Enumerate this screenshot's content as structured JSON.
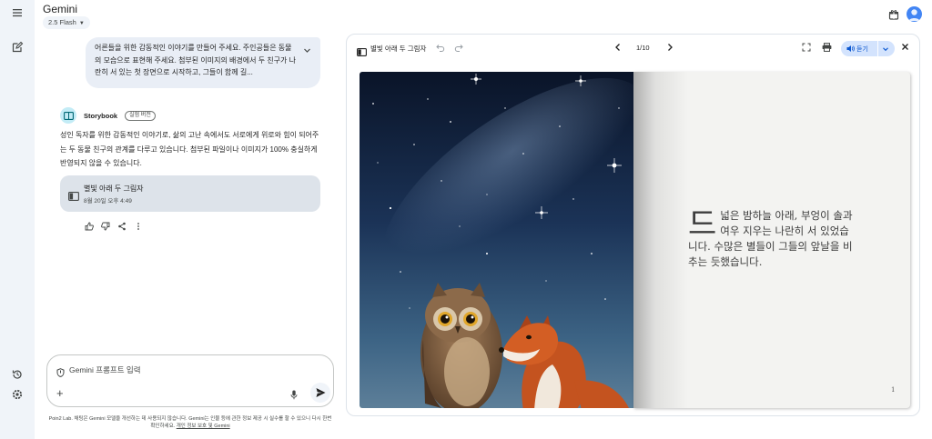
{
  "app": {
    "title": "Gemini",
    "model_label": "2.5 Flash"
  },
  "user_prompt": {
    "text": "어른들을 위한 감동적인 이야기를 만들어 주세요. 주인공들은 동물의 모습으로 표현해 주세요. 첨부된 이미지의 배경에서 두 친구가 나란히 서 있는 첫 장면으로 시작하고, 그들이 함께 길..."
  },
  "response": {
    "source_name": "Storybook",
    "source_badge": "실험 버전",
    "text": "성인 독자를 위한 감동적인 이야기로, 삶의 고난 속에서도 서로에게 위로와 힘이 되어주는 두 동물 친구의 관계를 다루고 있습니다. 첨부된 파일이나 이미지가 100% 충실하게 반영되지 않을 수 있습니다.",
    "card_title": "별빛 아래 두 그림자",
    "card_date": "8월 20일 오후 4:49"
  },
  "input": {
    "placeholder": "Gemini 프롬프트 입력"
  },
  "disclaimer": {
    "text": "Poin2 Lab. 채팅은 Gemini 모델을 개선하는 데 사용되지 않습니다. Gemini는 인물 등에 관한 정보 제공 시 실수를 할 수 있으니 다시 한번 확인하세요.",
    "link": "개인 정보 보호 및 Gemini"
  },
  "storybook": {
    "title": "별빛 아래 두 그림자",
    "page_indicator": "1/10",
    "listen_label": "듣기",
    "dropcap": "드",
    "page_text": "넓은 밤하늘 아래, 부엉이 솔과 여우 지우는 나란히 서 있었습니다. 수많은 별들이 그들의 앞날을 비추는 듯했습니다.",
    "page_number": "1"
  },
  "icons": {
    "rail": [
      "menu-icon",
      "new-chat-icon",
      "activity-icon",
      "settings-icon"
    ],
    "header": [
      "gift-icon",
      "avatar"
    ],
    "toolbar": [
      "book-icon",
      "undo-icon",
      "redo-icon",
      "prev-page-icon",
      "next-page-icon",
      "fullscreen-icon",
      "print-icon",
      "speaker-icon",
      "chevron-down-icon",
      "close-icon"
    ],
    "actions": [
      "thumb-up-icon",
      "thumb-down-icon",
      "share-icon",
      "more-icon"
    ]
  },
  "colors": {
    "accent": "#0b57d0",
    "listen_bg": "#d3e3fd",
    "user_bubble": "#e9eef6",
    "card_bg": "#dde3ea",
    "storybook_logo": "#c3ecf6",
    "rail_bg": "#f0f4f9"
  }
}
